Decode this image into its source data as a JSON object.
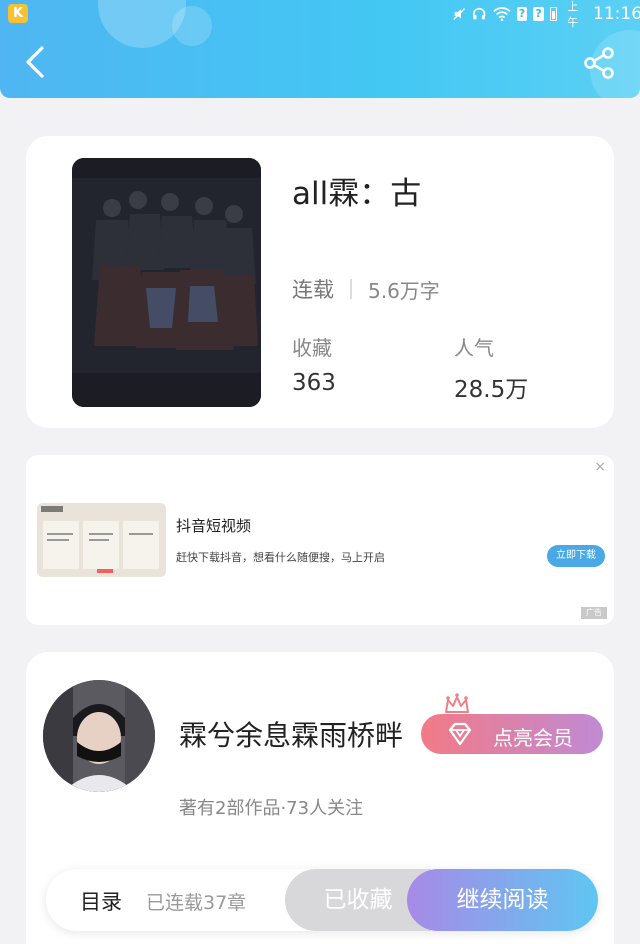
{
  "status_bar": {
    "app_badge": "K",
    "carrier_marks": [
      "?",
      "?"
    ],
    "ampm": "上午",
    "time": "11:16"
  },
  "header": {
    "back_icon": "chevron-left-icon",
    "share_icon": "share-icon"
  },
  "book": {
    "title": "all霖：古",
    "status": "连载",
    "word_count": "5.6万字",
    "favorites_label": "收藏",
    "favorites_value": "363",
    "popularity_label": "人气",
    "popularity_value": "28.5万"
  },
  "ad": {
    "close": "×",
    "title": "抖音短视频",
    "description": "赶快下载抖音，想看什么随便搜，马上开启",
    "button": "立即下载",
    "tag": "广告"
  },
  "author": {
    "name": "霖兮余息霖雨桥畔",
    "vip_button": "点亮会员",
    "meta": "著有2部作品·73人关注"
  },
  "bottom_bar": {
    "toc_label": "目录",
    "toc_count": "已连载37章",
    "favorited_button": "已收藏",
    "continue_button": "继续阅读"
  },
  "colors": {
    "header_start": "#4fb6f2",
    "header_end": "#5bd0f5",
    "vip_start": "#f27a86",
    "vip_end": "#c08ad4",
    "read_start": "#a78ae6",
    "read_end": "#5fc6f2",
    "ad_button": "#49a8e6"
  }
}
